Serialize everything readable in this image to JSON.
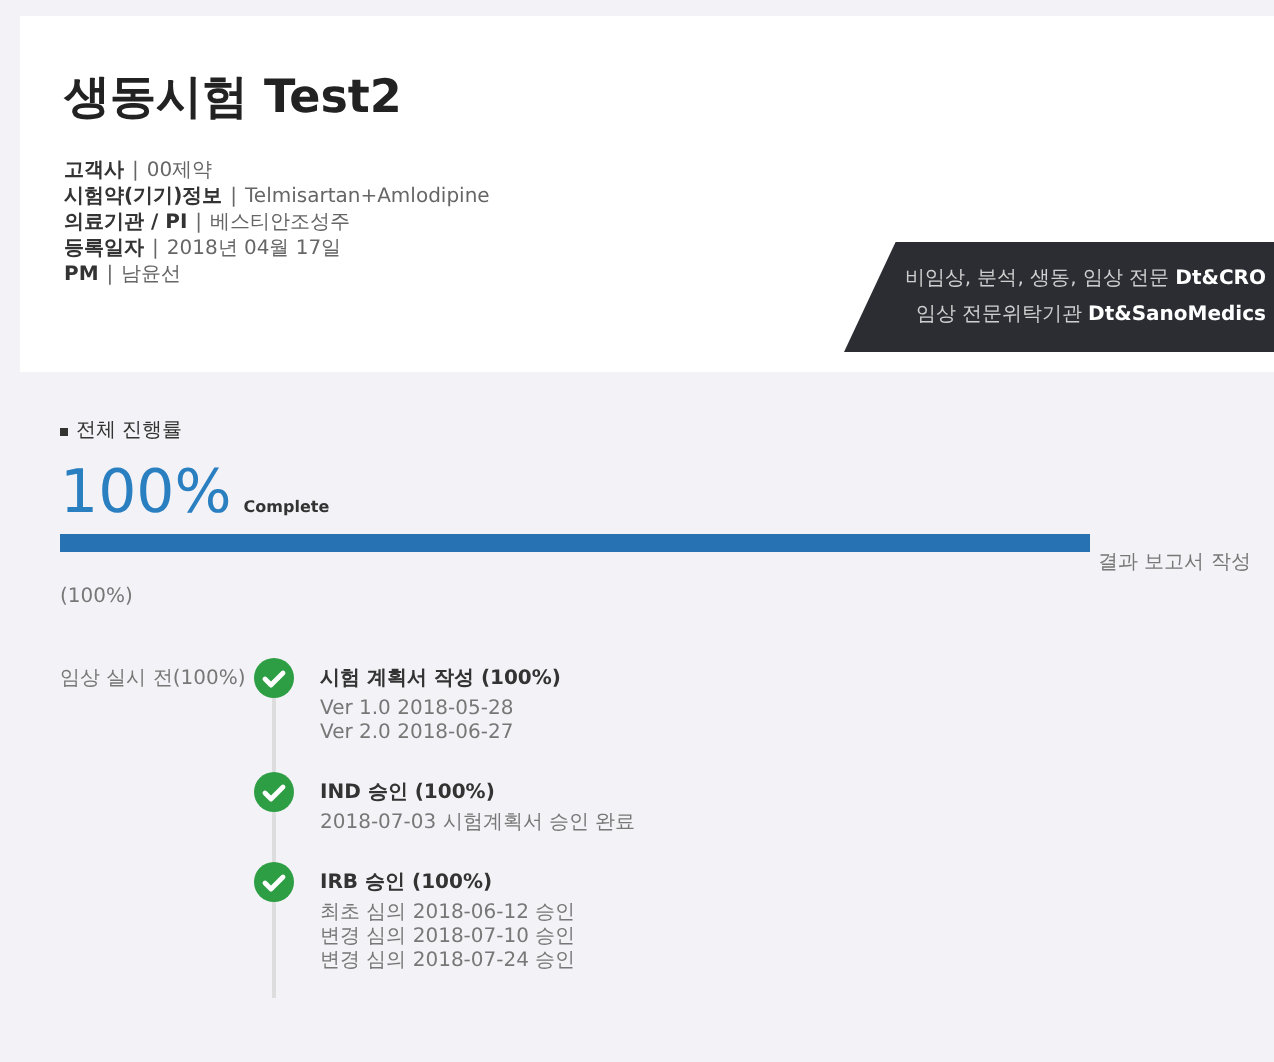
{
  "title": "생동시험 Test2",
  "info": [
    {
      "label": "고객사",
      "separator": "|",
      "value": "00제약"
    },
    {
      "label": "시험약(기기)정보",
      "separator": "|",
      "value": "Telmisartan+Amlodipine"
    },
    {
      "label": "의료기관 / PI",
      "separator": "|",
      "value": "베스티안조성주"
    },
    {
      "label": "등록일자",
      "separator": "|",
      "value": "2018년 04월 17일"
    },
    {
      "label": "PM",
      "separator": "|",
      "value": "남윤선"
    }
  ],
  "banner": {
    "lines": [
      {
        "text": "비임상, 분석, 생동, 임상 전문",
        "brand": "Dt&CRO"
      },
      {
        "text": "임상 전문위탁기관",
        "brand": "Dt&SanoMedics"
      }
    ]
  },
  "progress": {
    "heading": "전체 진행률",
    "percent": "100%",
    "status": "Complete",
    "level": 1,
    "sub": "(100%)",
    "end_label": "결과 보고서 작성"
  },
  "phase": "임상 실시 전(100%)",
  "steps": [
    {
      "title": "시험 계획서 작성 (100%)",
      "done": true,
      "lines": [
        "Ver 1.0 2018-05-28",
        "Ver 2.0 2018-06-27"
      ]
    },
    {
      "title": "IND 승인 (100%)",
      "done": true,
      "lines": [
        "2018-07-03 시험계획서 승인 완료"
      ]
    },
    {
      "title": "IRB 승인 (100%)",
      "done": true,
      "lines": [
        "최초 심의 2018-06-12 승인",
        "변경 심의 2018-07-10 승인",
        "변경 심의 2018-07-24 승인"
      ]
    }
  ]
}
